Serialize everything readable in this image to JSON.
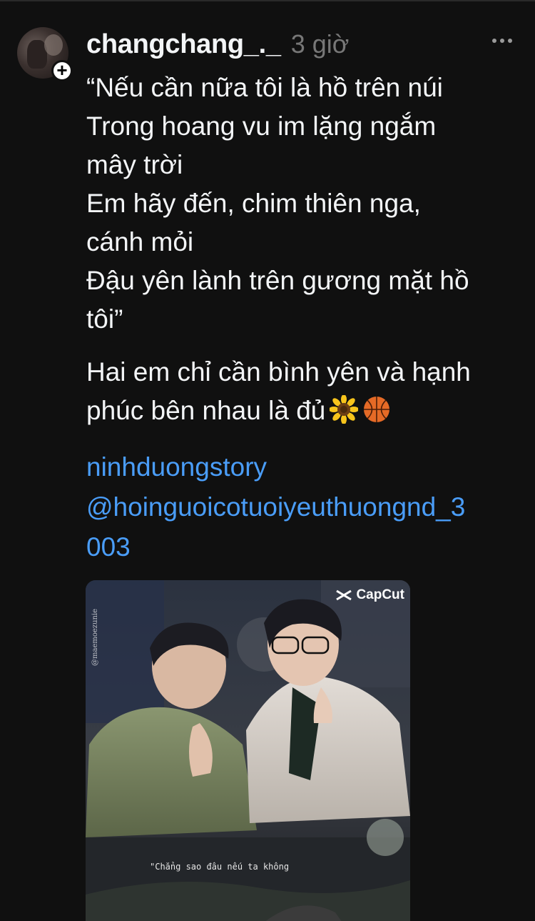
{
  "post": {
    "username": "changchang_._",
    "time": "3 giờ",
    "poem_lines": [
      "“Nếu cần nữa tôi là hồ trên núi",
      "Trong hoang vu im lặng ngắm",
      "mây trời",
      "Em hãy đến, chim thiên nga,",
      "cánh mỏi",
      "Đậu yên lành trên gương mặt hồ",
      "tôi”"
    ],
    "caption_lines": [
      "Hai em chỉ cần bình yên và hạnh",
      "phúc bên nhau là đủ"
    ],
    "caption_emojis": [
      "sunflower-emoji",
      "basketball-emoji"
    ],
    "links": [
      "ninhduongstory",
      "@hoinguoicotuoiyeuthuongnd_3",
      "003"
    ],
    "media": {
      "brand": "CapCut",
      "subtitle": "\"Chẳng sao đâu nếu ta không",
      "side_tag": "@maemoezunie"
    }
  },
  "icons": {
    "follow": "plus-icon",
    "more": "more-horizontal-icon"
  },
  "colors": {
    "background": "#101010",
    "text": "#f3f5f7",
    "muted": "#777777",
    "link": "#4a9df8"
  }
}
